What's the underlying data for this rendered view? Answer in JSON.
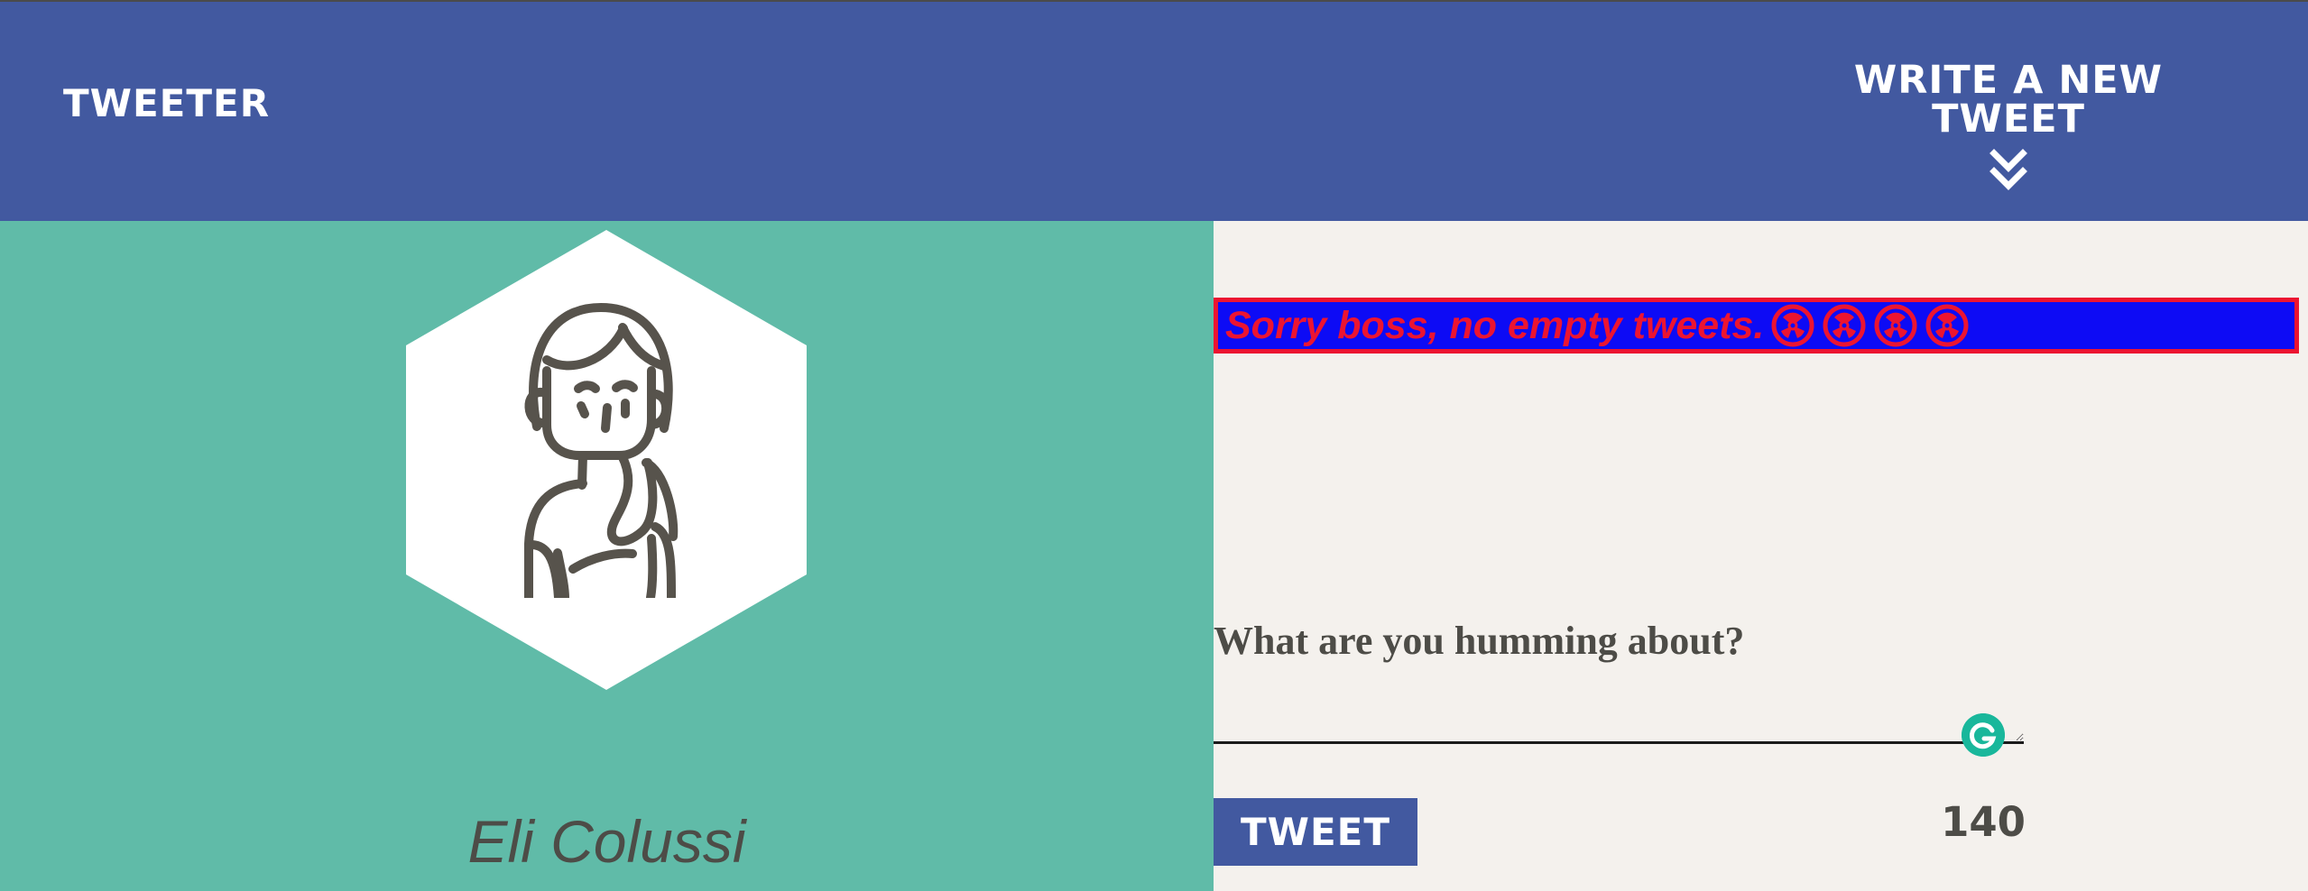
{
  "app": {
    "brand": "Tweeter",
    "compose_label": "Write a new tweet",
    "colors": {
      "nav": "#4259a0",
      "profile_panel": "#60bba8",
      "page_background": "#f4f1ed",
      "error_background": "#0d0bf5",
      "error_text": "#ec1431",
      "text": "#4d4c47"
    }
  },
  "profile": {
    "name": "Eli Colussi",
    "avatar_icon": "person-avatar-icon"
  },
  "error": {
    "message": "Sorry boss, no empty tweets.",
    "icons": [
      "hazard-icon",
      "hazard-icon",
      "hazard-icon",
      "hazard-icon"
    ]
  },
  "composer": {
    "prompt": "What are you humming about?",
    "button_label": "Tweet",
    "remaining_characters": "140"
  }
}
